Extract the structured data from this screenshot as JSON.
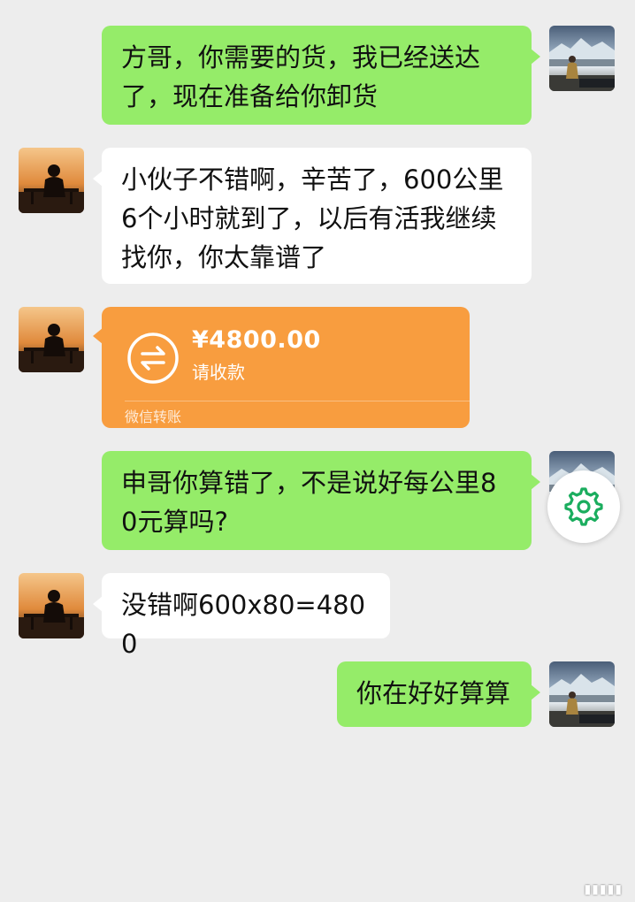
{
  "messages": [
    {
      "side": "right",
      "text": "方哥，你需要的货，我已经送达\n了，现在准备给你卸货"
    },
    {
      "side": "left",
      "text": "小伙子不错啊，辛苦了，600公里\n6个小时就到了，以后有活我继续\n找你，你太靠谱了"
    },
    {
      "side": "right",
      "text": "申哥你算错了，不是说好每公里8\n0元算吗?"
    },
    {
      "side": "left",
      "text": "没错啊600x80=4800"
    },
    {
      "side": "right",
      "text": "你在好好算算"
    }
  ],
  "transfer": {
    "amount": "¥4800.00",
    "status": "请收款",
    "source": "微信转账",
    "color": "#f89d3f"
  },
  "colors": {
    "background": "#ededed",
    "self_bubble": "#95ec69",
    "other_bubble": "#ffffff",
    "gear_accent": "#1aad5e"
  },
  "icons": {
    "transfer_icon": "transfer-arrows-icon",
    "floating_button": "gear-icon"
  }
}
